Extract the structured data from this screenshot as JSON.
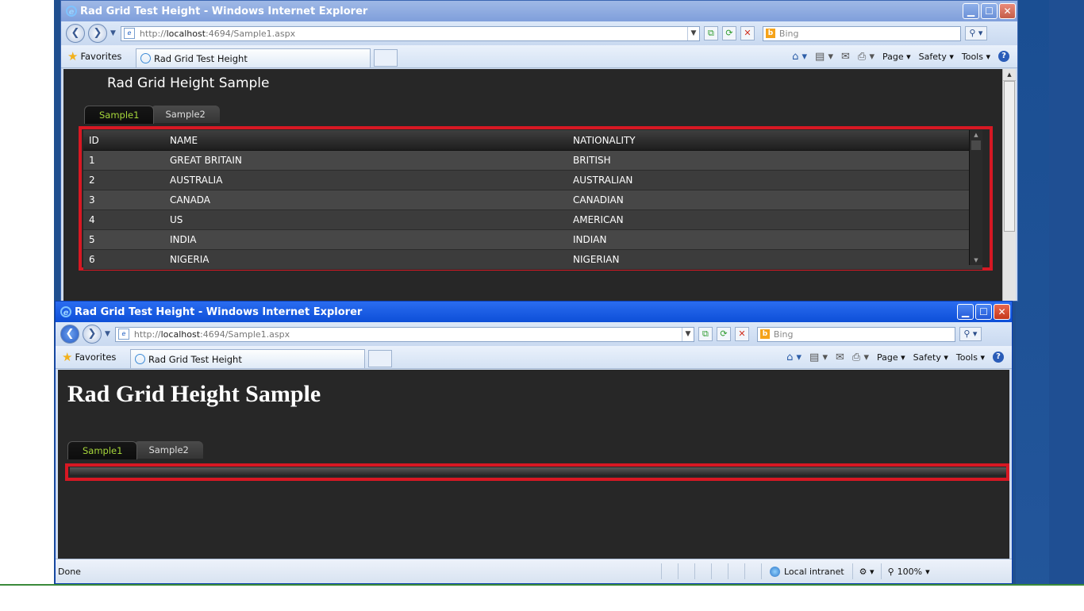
{
  "browser": {
    "title": "Rad Grid Test Height - Windows Internet Explorer",
    "address_prefix": "http://",
    "address_host": "localhost",
    "address_rest": ":4694/Sample1.aspx",
    "search_placeholder": "Bing",
    "favorites_label": "Favorites",
    "tab_title": "Rad Grid Test Height",
    "cmd_page": "Page",
    "cmd_safety": "Safety",
    "cmd_tools": "Tools"
  },
  "window_back": {
    "page_heading": "Rad Grid Height Sample",
    "tabs": [
      "Sample1",
      "Sample2"
    ],
    "grid": {
      "columns": [
        "ID",
        "NAME",
        "NATIONALITY"
      ],
      "rows": [
        {
          "id": "1",
          "name": "GREAT BRITAIN",
          "nationality": "BRITISH"
        },
        {
          "id": "2",
          "name": "AUSTRALIA",
          "nationality": "AUSTRALIAN"
        },
        {
          "id": "3",
          "name": "CANADA",
          "nationality": "CANADIAN"
        },
        {
          "id": "4",
          "name": "US",
          "nationality": "AMERICAN"
        },
        {
          "id": "5",
          "name": "INDIA",
          "nationality": "INDIAN"
        },
        {
          "id": "6",
          "name": "NIGERIA",
          "nationality": "NIGERIAN"
        }
      ]
    }
  },
  "window_front": {
    "page_heading": "Rad Grid Height Sample",
    "tabs": [
      "Sample1",
      "Sample2"
    ],
    "status_text": "Done",
    "zone_text": "Local intranet",
    "zoom_text": "100%"
  },
  "colors": {
    "highlight_box": "#d71823",
    "selected_tab_text": "#a6d63a",
    "page_background": "#272727"
  }
}
